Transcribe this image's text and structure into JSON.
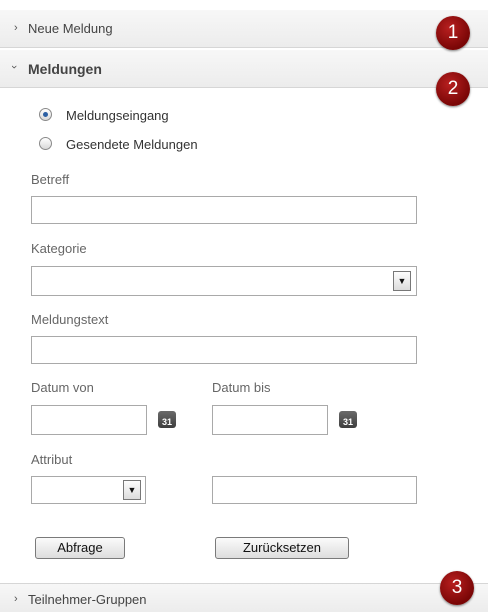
{
  "sections": {
    "neue_meldung": {
      "label": "Neue Meldung",
      "chevron": "›",
      "badge": "1"
    },
    "meldungen": {
      "label": "Meldungen",
      "chevron": "›",
      "badge": "2"
    },
    "teilnehmer": {
      "label": "Teilnehmer-Gruppen",
      "chevron": "›",
      "badge": "3"
    }
  },
  "form": {
    "radio_inbox": {
      "label": "Meldungseingang",
      "checked": true
    },
    "radio_sent": {
      "label": "Gesendete Meldungen",
      "checked": false
    },
    "betreff": {
      "label": "Betreff",
      "value": ""
    },
    "kategorie": {
      "label": "Kategorie",
      "selected": ""
    },
    "meldungstext": {
      "label": "Meldungstext",
      "value": ""
    },
    "datum_von": {
      "label": "Datum von",
      "value": ""
    },
    "datum_bis": {
      "label": "Datum bis",
      "value": ""
    },
    "calendar_icon_text": "31",
    "attribut": {
      "label": "Attribut",
      "selected": "",
      "value": ""
    },
    "dropdown_arrow": "▼",
    "buttons": {
      "query": "Abfrage",
      "reset": "Zurücksetzen"
    }
  },
  "colors": {
    "badge": "#8b0b0b",
    "radio_dot": "#2b5fa3"
  }
}
